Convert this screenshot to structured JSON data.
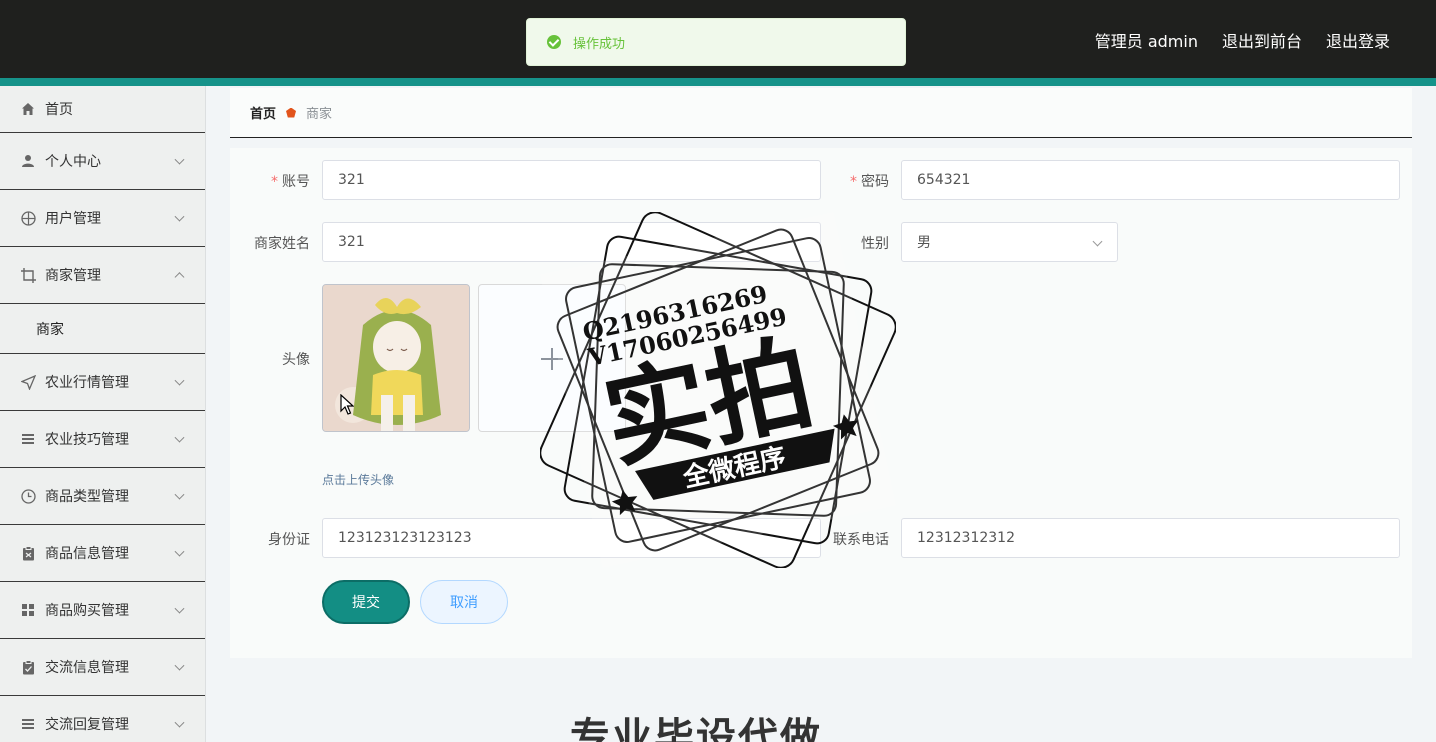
{
  "header": {
    "admin_label": "管理员 admin",
    "front_link": "退出到前台",
    "logout_link": "退出登录"
  },
  "toast": {
    "message": "操作成功"
  },
  "sidebar": {
    "items": [
      {
        "label": "首页",
        "icon": "home-icon"
      },
      {
        "label": "个人中心",
        "icon": "user-icon"
      },
      {
        "label": "用户管理",
        "icon": "circle-grid-icon"
      },
      {
        "label": "商家管理",
        "icon": "crop-icon",
        "expanded": true
      },
      {
        "label": "农业行情管理",
        "icon": "send-icon"
      },
      {
        "label": "农业技巧管理",
        "icon": "list-icon"
      },
      {
        "label": "商品类型管理",
        "icon": "clock-icon"
      },
      {
        "label": "商品信息管理",
        "icon": "clipboard-icon"
      },
      {
        "label": "商品购买管理",
        "icon": "grid-icon"
      },
      {
        "label": "交流信息管理",
        "icon": "clipboard-check-icon"
      },
      {
        "label": "交流回复管理",
        "icon": "list-icon"
      }
    ],
    "subitem": "商家"
  },
  "breadcrumb": {
    "home": "首页",
    "current": "商家"
  },
  "form": {
    "account_label": "账号",
    "account_value": "321",
    "password_label": "密码",
    "password_value": "654321",
    "name_label": "商家姓名",
    "name_value": "321",
    "gender_label": "性别",
    "gender_value": "男",
    "avatar_label": "头像",
    "upload_tip": "点击上传头像",
    "id_label": "身份证",
    "id_value": "123123123123123",
    "phone_label": "联系电话",
    "phone_value": "12312312312",
    "submit_label": "提交",
    "cancel_label": "取消"
  },
  "watermark": {
    "line1": "Q2196316269",
    "line2": "V17060256499",
    "main": "实拍",
    "ribbon": "全微程序"
  },
  "bottom_banner": "专业毕设代做",
  "colors": {
    "header_bg": "#1f201e",
    "accent": "#16938a",
    "submit": "#138e84"
  }
}
